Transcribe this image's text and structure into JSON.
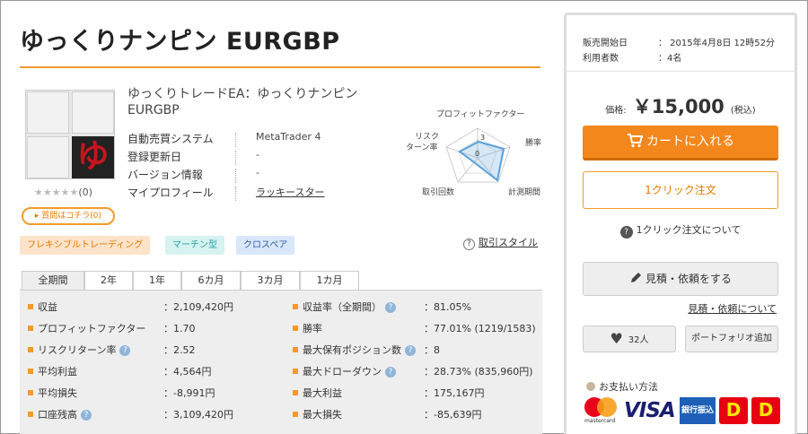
{
  "product": {
    "title": "ゆっくりナンピン EURGBP",
    "name": "ゆっくりトレードEA：ゆっくりナンピン EURGBP",
    "logo_char": "ゆ",
    "rating_stars": "★★★★★",
    "rating_count": "(0)",
    "question_button": "▸ 質問はコチラ(0)"
  },
  "info": [
    {
      "label": "自動売買システム",
      "value": "MetaTrader 4"
    },
    {
      "label": "登録更新日",
      "value": "-"
    },
    {
      "label": "バージョン情報",
      "value": "-"
    },
    {
      "label": "マイプロフィール",
      "value": "ラッキースター"
    }
  ],
  "radar": {
    "labels": {
      "top": "プロフィットファクター",
      "right": "勝率",
      "bottom_right": "計測期間",
      "bottom_left": "取引回数",
      "left_line1": "リスク",
      "left_line2": "ターン率"
    },
    "scale_labels": [
      "3",
      "0"
    ]
  },
  "tags": [
    "フレキシブルトレーディング",
    "マーチン型",
    "クロスペア"
  ],
  "guide_link": "取引スタイル",
  "period_tabs": [
    "全期間",
    "2年",
    "1年",
    "6カ月",
    "3カ月",
    "1カ月"
  ],
  "stats": [
    [
      {
        "label": "収益",
        "value": "：2,109,420円",
        "help": false
      },
      {
        "label": "収益率（全期間）",
        "value": "：81.05%",
        "help": true
      }
    ],
    [
      {
        "label": "プロフィットファクター",
        "value": "：1.70",
        "help": false
      },
      {
        "label": "勝率",
        "value": "：77.01% (1219/1583)",
        "help": false
      }
    ],
    [
      {
        "label": "リスクリターン率",
        "value": "：2.52",
        "help": true
      },
      {
        "label": "最大保有ポジション数",
        "value": "：8",
        "help": true
      }
    ],
    [
      {
        "label": "平均利益",
        "value": "：4,564円",
        "help": false
      },
      {
        "label": "最大ドローダウン",
        "value": "：28.73% (835,960円)",
        "help": true
      }
    ],
    [
      {
        "label": "平均損失",
        "value": "：-8,991円",
        "help": false
      },
      {
        "label": "最大利益",
        "value": "：175,167円",
        "help": false
      }
    ],
    [
      {
        "label": "口座残高",
        "value": "：3,109,420円",
        "help": true
      },
      {
        "label": "最大損失",
        "value": "：-85,639円",
        "help": false
      }
    ]
  ],
  "sidebar": {
    "sale_start_label": "販売開始日",
    "sale_start_value": "：  2015年4月8日 12時52分",
    "users_label": "利用者数",
    "users_value": "：4名",
    "price_label": "価格:",
    "price_value": "￥15,000",
    "tax_label": "(税込)",
    "cart_button": "カートに入れる",
    "oneclick_button": "1クリック注文",
    "oneclick_about": "1クリック注文について",
    "estimate_button": "見積・依頼をする",
    "estimate_about": "見積・依頼について",
    "favorite_count": "32人",
    "portfolio_button": "ポートフォリオ追加",
    "payment_title": "お支払い方法",
    "payment_logos": {
      "mastercard": "mastercard",
      "visa": "VISA",
      "bank": "銀行振込",
      "d1": "D",
      "d2": "D"
    }
  },
  "colors": {
    "accent": "#f39a2a",
    "cart": "#f3871c",
    "radar": "#5aa0d8"
  }
}
